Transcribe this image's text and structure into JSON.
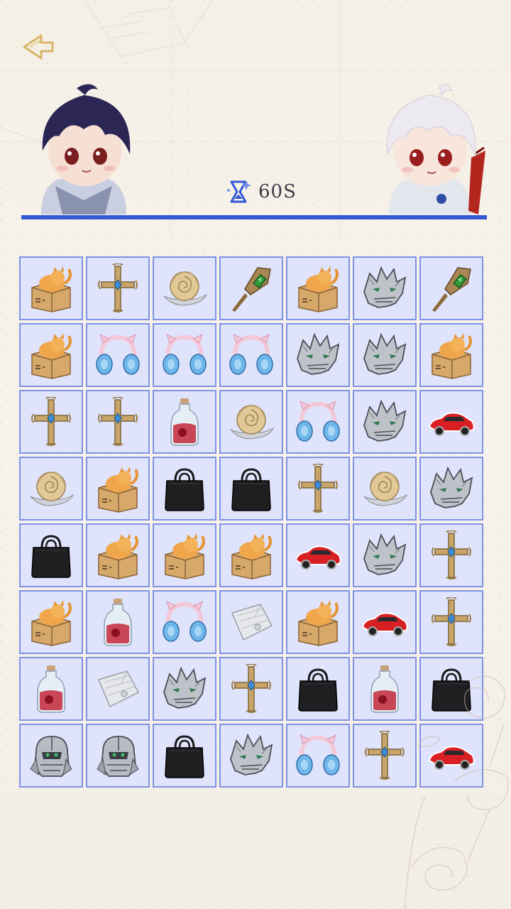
{
  "timer": {
    "label": "60S",
    "icon": "hourglass-icon"
  },
  "progress": {
    "fraction": 1.0,
    "color": "#3459d6"
  },
  "players": {
    "left": {
      "name": "",
      "hair": "#2b2654"
    },
    "right": {
      "name": "",
      "hair": "#eceaf0"
    }
  },
  "board": {
    "rows": 8,
    "cols": 7,
    "items": [
      [
        "cat-box",
        "cross",
        "rose",
        "emerald-dagger",
        "cat-box",
        "wolf-helm",
        "emerald-dagger"
      ],
      [
        "cat-box",
        "headphones",
        "headphones",
        "headphones",
        "wolf-helm",
        "wolf-helm",
        "cat-box"
      ],
      [
        "cross",
        "cross",
        "potion-bottle",
        "rose",
        "headphones",
        "wolf-helm",
        "red-car"
      ],
      [
        "rose",
        "cat-box",
        "black-bag",
        "black-bag",
        "cross",
        "rose",
        "wolf-helm"
      ],
      [
        "black-bag",
        "cat-box",
        "cat-box",
        "cat-box",
        "red-car",
        "wolf-helm",
        "cross"
      ],
      [
        "cat-box",
        "potion-bottle",
        "headphones",
        "silver-cloth",
        "cat-box",
        "red-car",
        "cross"
      ],
      [
        "potion-bottle",
        "silver-cloth",
        "wolf-helm",
        "cross",
        "black-bag",
        "potion-bottle",
        "black-bag"
      ],
      [
        "knight-armor",
        "knight-armor",
        "black-bag",
        "wolf-helm",
        "headphones",
        "cross",
        "red-car"
      ]
    ]
  }
}
